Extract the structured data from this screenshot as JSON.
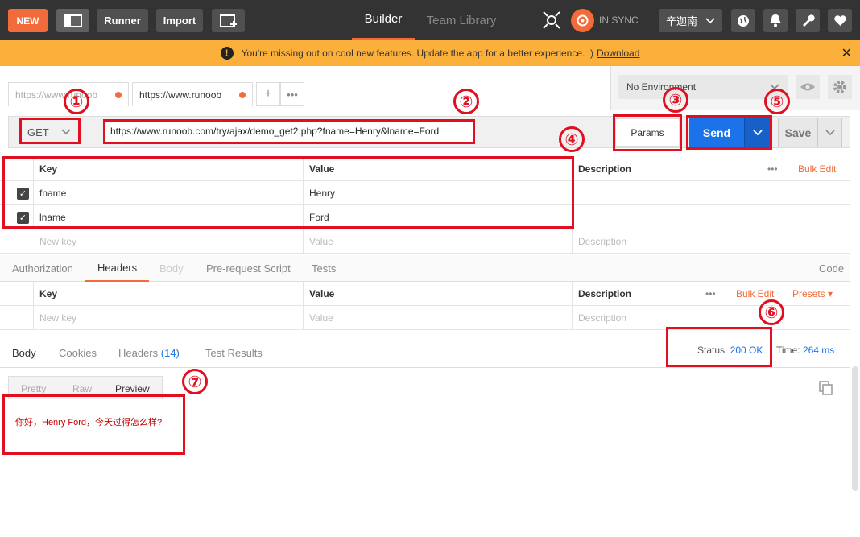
{
  "topbar": {
    "new_label": "NEW",
    "runner_label": "Runner",
    "import_label": "Import",
    "builder_tab": "Builder",
    "team_library_tab": "Team Library",
    "sync_status": "IN SYNC",
    "user_name": "辛迦南"
  },
  "banner": {
    "message": "You're missing out on cool new features. Update the app for a better experience. :)",
    "link": "Download"
  },
  "request_tabs": [
    {
      "label": "https://www.runoob"
    },
    {
      "label": "https://www.runoob"
    }
  ],
  "environment": {
    "selected": "No Environment"
  },
  "request": {
    "method": "GET",
    "url": "https://www.runoob.com/try/ajax/demo_get2.php?fname=Henry&lname=Ford",
    "params_label": "Params",
    "send_label": "Send",
    "save_label": "Save"
  },
  "params_table": {
    "headers": {
      "key": "Key",
      "value": "Value",
      "description": "Description"
    },
    "bulk_edit": "Bulk Edit",
    "rows": [
      {
        "key": "fname",
        "value": "Henry"
      },
      {
        "key": "lname",
        "value": "Ford"
      }
    ],
    "placeholder": {
      "key": "New key",
      "value": "Value",
      "description": "Description"
    }
  },
  "request_subtabs": {
    "tabs": [
      "Authorization",
      "Headers",
      "Body",
      "Pre-request Script",
      "Tests"
    ],
    "active": "Headers",
    "code_link": "Code"
  },
  "headers_table": {
    "headers": {
      "key": "Key",
      "value": "Value",
      "description": "Description"
    },
    "bulk_edit": "Bulk Edit",
    "presets": "Presets",
    "placeholder": {
      "key": "New key",
      "value": "Value",
      "description": "Description"
    }
  },
  "response": {
    "tabs": {
      "body": "Body",
      "cookies": "Cookies",
      "headers": "Headers",
      "headers_count": "(14)",
      "tests": "Test Results"
    },
    "status_label": "Status:",
    "status_value": "200 OK",
    "time_label": "Time:",
    "time_value": "264 ms",
    "view_tabs": [
      "Pretty",
      "Raw",
      "Preview"
    ],
    "active_view": "Preview",
    "preview_text": "你好，Henry Ford，今天过得怎么样?"
  },
  "annotations": [
    "①",
    "②",
    "③",
    "④",
    "⑤",
    "⑥",
    "⑦"
  ],
  "colors": {
    "accent": "#f26b3a",
    "send": "#1c72e8",
    "banner": "#fbb03b",
    "annotation": "#e01020"
  }
}
